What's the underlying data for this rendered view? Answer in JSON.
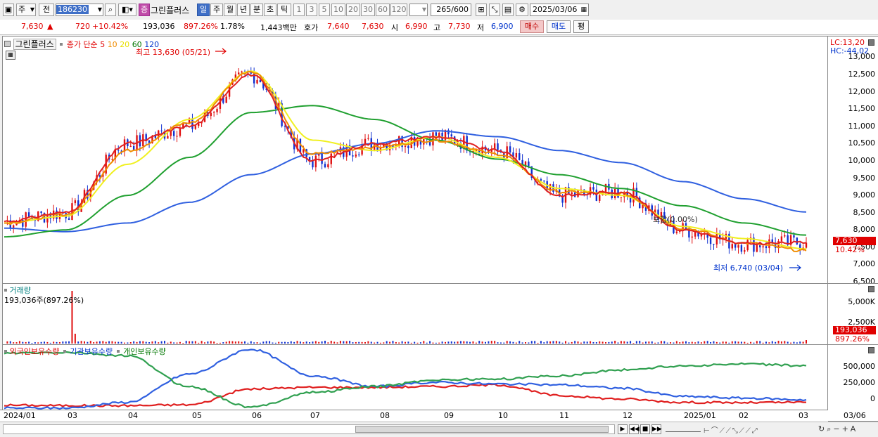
{
  "toolbar": {
    "period_prefix": "주",
    "compare_label": "전",
    "stock_code": "186230",
    "badge": "증",
    "stock_name": "그린플러스",
    "periods": [
      "일",
      "주",
      "월",
      "년",
      "분",
      "초",
      "틱"
    ],
    "selected_period": "일",
    "intervals": [
      "1",
      "3",
      "5",
      "10",
      "20",
      "30",
      "60",
      "120"
    ],
    "count_value": "265",
    "count_total": "/600",
    "date": "2025/03/06"
  },
  "quote": {
    "price": "7,630",
    "change_arrow": "▲",
    "change": "720",
    "change_pct": "+10.42%",
    "volume": "193,036",
    "volume_ratio": "897.26%",
    "turnover": "1.78%",
    "amount": "1,443백만",
    "ask_label": "호가",
    "ask": "7,640",
    "bid": "7,630",
    "open_label": "시",
    "open": "6,990",
    "high_label": "고",
    "high": "7,730",
    "low_label": "저",
    "low": "6,900",
    "buy_button": "매수",
    "sell_button": "매도",
    "eval_button": "평"
  },
  "price_pane": {
    "title": "그린플러스",
    "ma_label": "종가 단순",
    "ma_periods": [
      "5",
      "10",
      "20",
      "60",
      "120"
    ],
    "ma_colors": [
      "#e02020",
      "#f08c00",
      "#f0f020",
      "#20a030",
      "#3060e0"
    ],
    "high_note": "최고 13,630 (05/21)",
    "low_note": "최저 6,740 (03/04)",
    "flat_note": "보합(0.00%)",
    "lc": "LC:13,20",
    "hc": "HC:-44,02",
    "yticks": [
      "13,000",
      "12,500",
      "12,000",
      "11,500",
      "11,000",
      "10,500",
      "10,000",
      "9,500",
      "9,000",
      "8,500",
      "8,000",
      "7,500",
      "7,000",
      "6,500"
    ],
    "current_price_tag": "7,630",
    "current_pct_tag": "10.42%"
  },
  "volume_pane": {
    "title": "거래량",
    "value_line": "193,036주(897.26%)",
    "yticks": [
      "5,000K",
      "2,500K"
    ],
    "current_tag": "193,036",
    "pct_tag": "897.26%"
  },
  "holding_pane": {
    "legend": [
      "외국인보유수량",
      "기관보유수량",
      "개인보유수량"
    ],
    "colors": [
      "#e02020",
      "#3060e0",
      "#30a050"
    ],
    "yticks": [
      "500,000",
      "250,000",
      "0"
    ]
  },
  "x_axis": [
    "2024/01",
    "03",
    "04",
    "05",
    "06",
    "07",
    "08",
    "09",
    "10",
    "11",
    "12",
    "2025/01",
    "02",
    "03",
    "03/06"
  ],
  "chart_data": [
    {
      "type": "line",
      "title": "그린플러스",
      "x": [
        "2024/01",
        "03",
        "04",
        "05",
        "06",
        "07",
        "08",
        "09",
        "10",
        "11",
        "12",
        "2025/01",
        "02",
        "03"
      ],
      "series": [
        {
          "name": "5",
          "values": [
            8250,
            8500,
            10500,
            11000,
            12500,
            10000,
            10500,
            10700,
            10300,
            9000,
            9100,
            8000,
            7600,
            7630
          ]
        },
        {
          "name": "10",
          "values": [
            8200,
            8450,
            10300,
            11100,
            12600,
            10200,
            10400,
            10600,
            10200,
            9100,
            9050,
            8050,
            7620,
            7400
          ]
        },
        {
          "name": "20",
          "values": [
            8200,
            8400,
            9900,
            11200,
            12600,
            10600,
            10300,
            10700,
            10100,
            9200,
            9000,
            8100,
            7750,
            7450
          ]
        },
        {
          "name": "60",
          "values": [
            7800,
            8000,
            9000,
            10100,
            11400,
            11600,
            11200,
            10600,
            10050,
            9600,
            9200,
            8700,
            8200,
            7850
          ]
        },
        {
          "name": "120",
          "values": [
            8050,
            7950,
            8200,
            8800,
            9600,
            10200,
            10500,
            10870,
            10700,
            10300,
            9950,
            9400,
            8900,
            8520
          ]
        }
      ],
      "high": {
        "value": 13630,
        "date": "05/21"
      },
      "low": {
        "value": 6740,
        "date": "03/04"
      },
      "ylim": [
        6500,
        13600
      ]
    },
    {
      "type": "bar",
      "title": "거래량",
      "note": "spike near 2024/02 ≈ 5,600K; last 193,036",
      "ylim": [
        0,
        6000000
      ]
    },
    {
      "type": "line",
      "series": [
        {
          "name": "외국인보유수량",
          "values": [
            25000,
            20000,
            20000,
            30000,
            220000,
            240000,
            240000,
            250000,
            270000,
            140000,
            100000,
            60000,
            55000,
            60000
          ]
        },
        {
          "name": "기관보유수량",
          "values": [
            -10000,
            -10000,
            60000,
            400000,
            700000,
            380000,
            250000,
            300000,
            280000,
            270000,
            230000,
            130000,
            110000,
            90000
          ]
        },
        {
          "name": "개인보유수량",
          "values": [
            650000,
            660000,
            620000,
            250000,
            0,
            180000,
            250000,
            330000,
            340000,
            380000,
            450000,
            500000,
            520000,
            500000
          ]
        }
      ],
      "ylim": [
        -20000,
        700000
      ]
    }
  ]
}
